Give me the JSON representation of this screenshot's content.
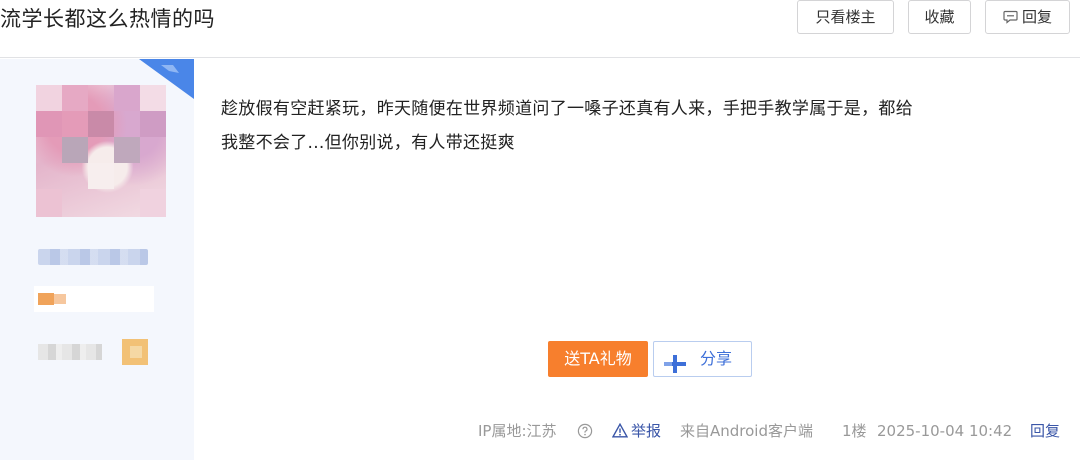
{
  "header": {
    "title": "流学长都这么热情的吗",
    "only_author_label": "只看楼主",
    "favorite_label": "收藏",
    "reply_label": "回复",
    "reply_icon": "comment-icon"
  },
  "post": {
    "content_line1": "趁放假有空赶紧玩，昨天随便在世界频道问了一嗓子还真有人来，手把手教学属于是，都给",
    "content_line2": "我整不会了...但你别说，有人带还挺爽",
    "gift_button_label": "送TA礼物",
    "share_button_label": "分享",
    "share_icon": "plus-cross-icon"
  },
  "meta": {
    "ip_location": "IP属地:江苏",
    "help_icon": "question-circle-icon",
    "report_label": "举报",
    "report_icon": "warning-triangle-icon",
    "client": "来自Android客户端",
    "floor": "1楼",
    "time": "2025-10-04 10:42",
    "reply_link": "回复"
  },
  "colors": {
    "accent_orange": "#f77f2d",
    "link_blue": "#3a56a8",
    "share_blue": "#3d6fd8",
    "user_column_bg": "#f4f7fd"
  }
}
